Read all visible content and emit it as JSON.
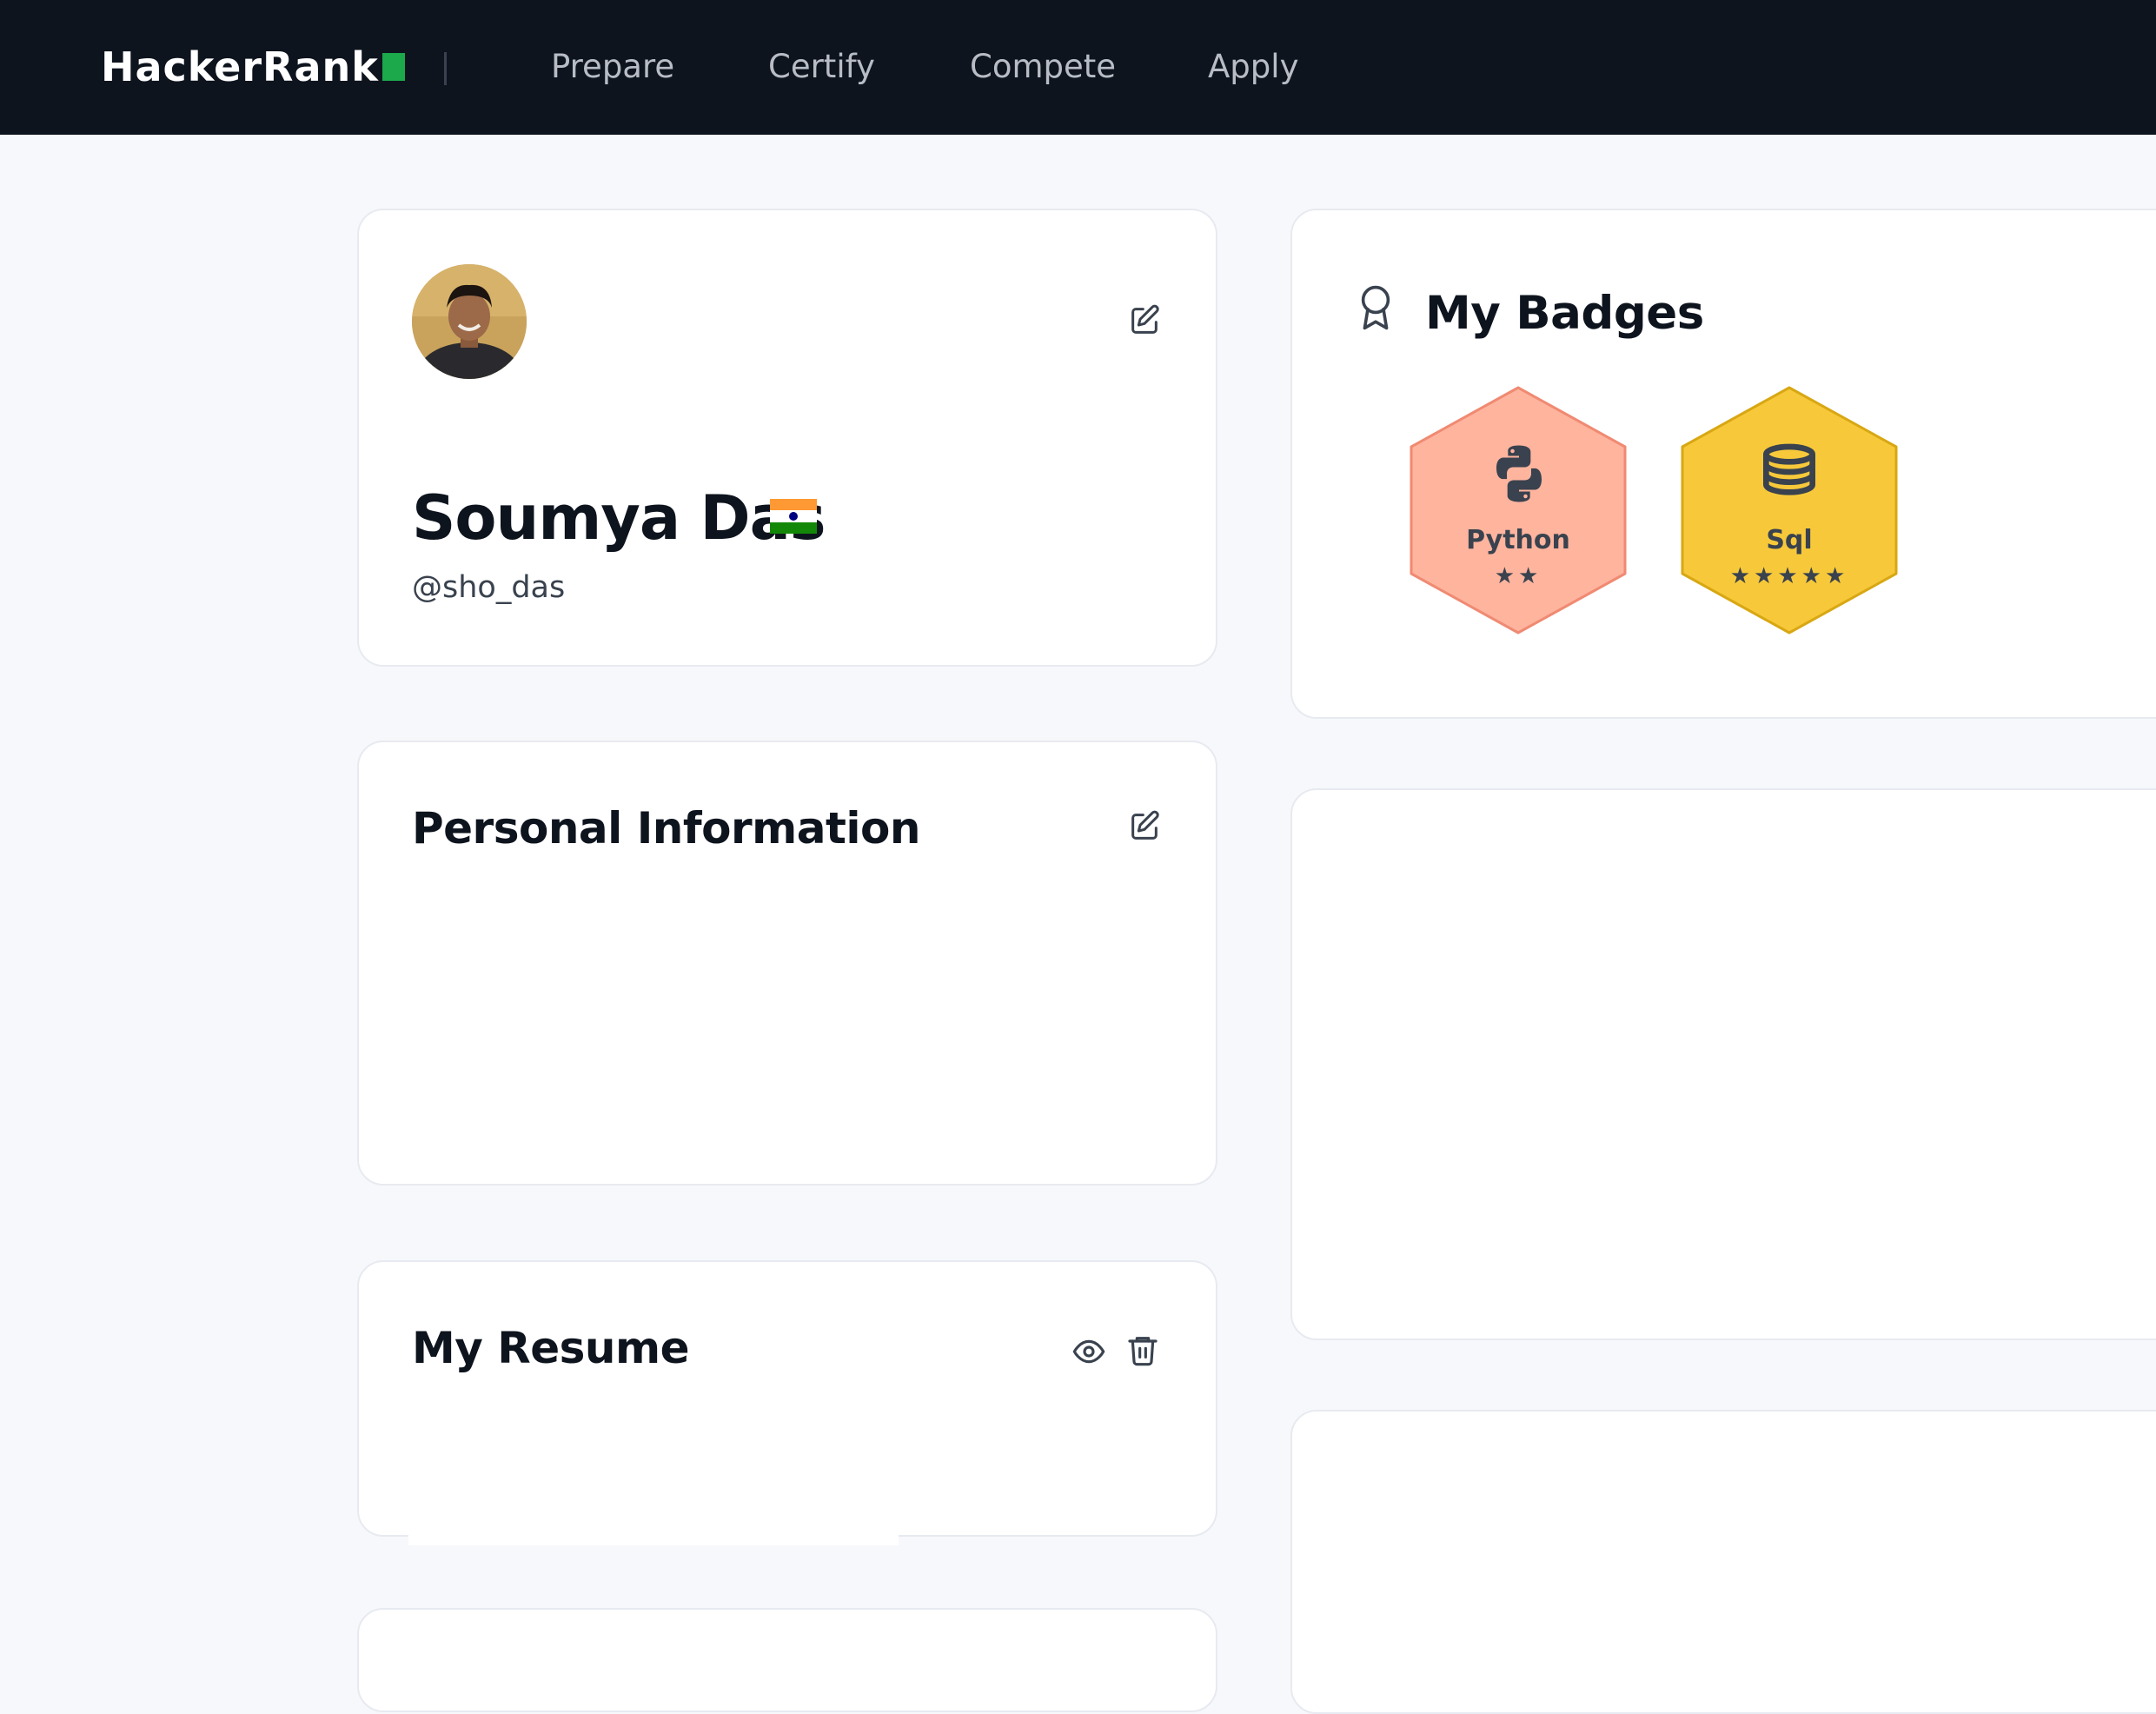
{
  "header": {
    "logo_text": "HackerRank",
    "nav": [
      "Prepare",
      "Certify",
      "Compete",
      "Apply"
    ]
  },
  "profile": {
    "name": "Soumya Das",
    "handle": "@sho_das",
    "country_flag": "india-flag-icon"
  },
  "personal_info": {
    "title": "Personal Information"
  },
  "resume": {
    "title": "My Resume"
  },
  "badges": {
    "title": "My Badges",
    "items": [
      {
        "label": "Python",
        "stars": 2,
        "stars_text": "★★",
        "color": "#ffb09a",
        "icon": "python-icon"
      },
      {
        "label": "Sql",
        "stars": 5,
        "stars_text": "★★★★★",
        "color": "#f7c531",
        "icon": "database-icon"
      }
    ]
  },
  "colors": {
    "topbar": "#0e141e",
    "brand_green": "#1ba94c",
    "page_bg": "#f7f8fb"
  }
}
